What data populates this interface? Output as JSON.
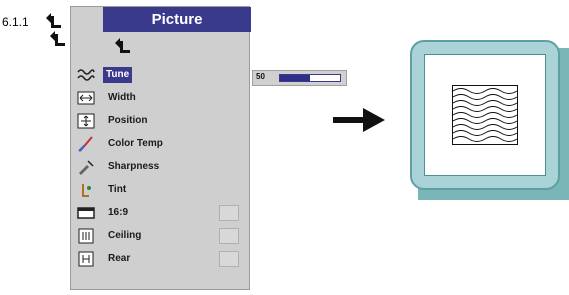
{
  "section_number": "6.1.1",
  "menu": {
    "title": "Picture",
    "items": [
      {
        "label": "Tune",
        "icon": "tune-icon",
        "selected": true,
        "toggle": false
      },
      {
        "label": "Width",
        "icon": "width-icon",
        "selected": false,
        "toggle": false
      },
      {
        "label": "Position",
        "icon": "position-icon",
        "selected": false,
        "toggle": false
      },
      {
        "label": "Color Temp",
        "icon": "color-temp-icon",
        "selected": false,
        "toggle": false
      },
      {
        "label": "Sharpness",
        "icon": "sharpness-icon",
        "selected": false,
        "toggle": false
      },
      {
        "label": "Tint",
        "icon": "tint-icon",
        "selected": false,
        "toggle": false
      },
      {
        "label": "16:9",
        "icon": "aspect-ratio-icon",
        "selected": false,
        "toggle": true
      },
      {
        "label": "Ceiling",
        "icon": "ceiling-icon",
        "selected": false,
        "toggle": true
      },
      {
        "label": "Rear",
        "icon": "rear-icon",
        "selected": false,
        "toggle": true
      }
    ]
  },
  "tune_slider": {
    "value_label": "50",
    "fraction": 0.5
  },
  "colors": {
    "menu_accent": "#3a3a8c",
    "display_frame": "#a9d3d6",
    "display_shadow": "#7ab6b8"
  }
}
